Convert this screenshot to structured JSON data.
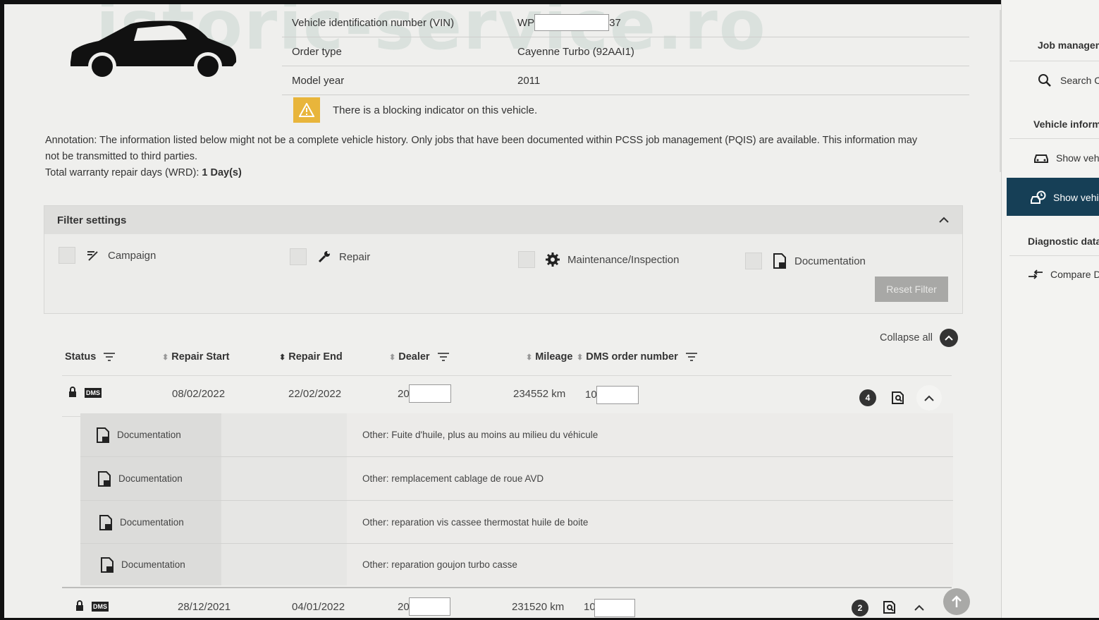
{
  "watermark": "istoric-service.ro",
  "vehicle": {
    "vin_label": "Vehicle identification number (VIN)",
    "vin_prefix": "WP",
    "vin_suffix": "37",
    "order_type_label": "Order type",
    "order_type_value": "Cayenne Turbo (92AAI1)",
    "model_year_label": "Model year",
    "model_year_value": "2011"
  },
  "warning": {
    "text": "There is a blocking indicator on this vehicle."
  },
  "annotation": {
    "text": "Annotation: The information listed below might not be a complete vehicle history. Only jobs that have been documented within PCSS job management (PQIS) are available. This information may not be transmitted to third parties.",
    "wrd_label": "Total warranty repair days (WRD):",
    "wrd_value": "1 Day(s)"
  },
  "filter": {
    "title": "Filter settings",
    "items": [
      "Campaign",
      "Repair",
      "Maintenance/Inspection",
      "Documentation"
    ],
    "reset_label": "Reset Filter"
  },
  "collapse_all": "Collapse all",
  "table": {
    "headers": [
      "Status",
      "Repair Start",
      "Repair End",
      "Dealer",
      "Mileage",
      "DMS order number"
    ],
    "rows": [
      {
        "dms": "DMS",
        "start": "08/02/2022",
        "end": "22/02/2022",
        "dealer_prefix": "20",
        "mileage": "234552 km",
        "dms_order_prefix": "10",
        "count": "4",
        "details": [
          {
            "type": "Documentation",
            "text": "Other: Fuite d'huile, plus au moins au milieu du véhicule"
          },
          {
            "type": "Documentation",
            "text": "Other: remplacement cablage de roue AVD"
          },
          {
            "type": "Documentation",
            "text": "Other: reparation vis cassee thermostat huile de boite"
          },
          {
            "type": "Documentation",
            "text": "Other: reparation goujon turbo casse"
          }
        ]
      },
      {
        "dms": "DMS",
        "start": "28/12/2021",
        "end": "04/01/2022",
        "dealer_prefix": "20",
        "mileage": "231520 km",
        "dms_order_prefix": "10",
        "count": "2"
      }
    ]
  },
  "sidebar": {
    "job_management": "Job managem",
    "search": "Search C",
    "vehicle_info": "Vehicle informa",
    "show_vehicle_1": "Show vehi",
    "show_vehicle_2": "Show vehi",
    "diagnostic": "Diagnostic data",
    "compare": "Compare D"
  },
  "colors": {
    "active_nav": "#163f56",
    "warning": "#e8b53b",
    "badge": "#333333"
  }
}
